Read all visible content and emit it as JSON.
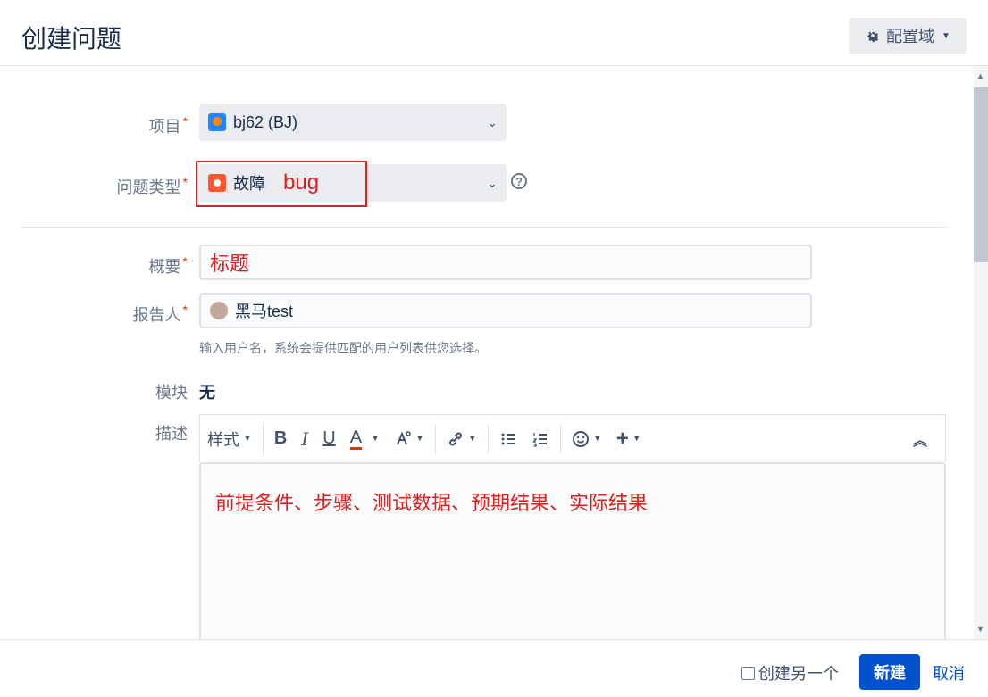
{
  "header": {
    "title": "创建问题",
    "config_label": "配置域"
  },
  "form": {
    "project": {
      "label": "项目",
      "value": "bj62 (BJ)"
    },
    "issue_type": {
      "label": "问题类型",
      "value": "故障",
      "annotation": "bug"
    },
    "summary": {
      "label": "概要",
      "value": "标题"
    },
    "reporter": {
      "label": "报告人",
      "value": "黑马test",
      "hint": "输入用户名，系统会提供匹配的用户列表供您选择。"
    },
    "component": {
      "label": "模块",
      "value": "无"
    },
    "description": {
      "label": "描述",
      "toolbar": {
        "style_label": "样式",
        "bold": "B",
        "italic": "I",
        "underline": "U",
        "text_color": "A"
      },
      "content": "前提条件、步骤、测试数据、预期结果、实际结果"
    }
  },
  "footer": {
    "create_another_label": "创建另一个",
    "create_label": "新建",
    "cancel_label": "取消"
  },
  "colors": {
    "primary": "#0052cc",
    "required": "#de350b",
    "annotation": "#e01e1e",
    "bug_icon": "#ff5630"
  }
}
